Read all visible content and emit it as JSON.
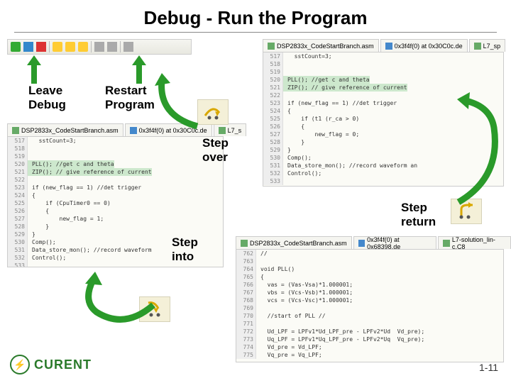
{
  "title": "Debug - Run the Program",
  "labels": {
    "leave_debug": "Leave\nDebug",
    "restart_program": "Restart\nProgram",
    "step_over": "Step\nover",
    "step_return": "Step\nreturn",
    "step_into": "Step\ninto"
  },
  "tabs_top": [
    "DSP2833x_CodeStartBranch.asm",
    "0x3f4f(0) at 0x30C0c.de",
    "L7_sp"
  ],
  "tabs_mid": [
    "DSP2833x_CodeStartBranch.asm",
    "0x3f4f(0) at 0x30C0c.de",
    "L7_s"
  ],
  "tabs_bot": [
    "DSP2833x_CodeStartBranch.asm",
    "0x3f4f(0) at 0x68398.de",
    "L7-solution_lin-c.C8"
  ],
  "code_top": {
    "start": 517,
    "lines": [
      "  sstCount=3;",
      "",
      "",
      "PLL(); //get c and theta",
      "ZIP(); // give reference of current",
      "",
      "if (new_flag == 1) //det trigger",
      "{",
      "    if (t1 (r_ca > 0)",
      "    {",
      "        new_flag = 0;",
      "    }",
      "}",
      "Comp();",
      "Data_store_mon(); //record waveform an",
      "Control();",
      ""
    ]
  },
  "code_mid": {
    "start": 517,
    "lines": [
      "  sstCount=3;",
      "",
      "",
      "PLL(); //get c and theta",
      "ZIP(); // give reference of current",
      "",
      "if (new_flag == 1) //det trigger",
      "{",
      "    if (CpuTimer0 == 0)",
      "    {",
      "        new_flag = 1;",
      "    }",
      "}",
      "Comp();",
      "Data_store_mon(); //record waveform",
      "Control();",
      ""
    ]
  },
  "code_bot": {
    "start": 762,
    "lines": [
      "//",
      "",
      "void PLL()",
      "{",
      "  vas = (Vas-Vsa)*1.000001;",
      "  vbs = (Vcs-Vsb)*1.000001;",
      "  vcs = (Vcs-Vsc)*1.000001;",
      "",
      "  //start of PLL //",
      "",
      "  Ud_LPF = LPFv1*Ud_LPF_pre - LPFv2*Ud  Vd_pre);",
      "  Uq_LPF = LPFv1*Uq_LPF_pre - LPFv2*Uq  Vq_pre);",
      "  Vd_pre = Vd_LPF;",
      "  Vq_pre = Vq_LPF;"
    ]
  },
  "logo_text": "CURENT",
  "page_num": "1-11"
}
